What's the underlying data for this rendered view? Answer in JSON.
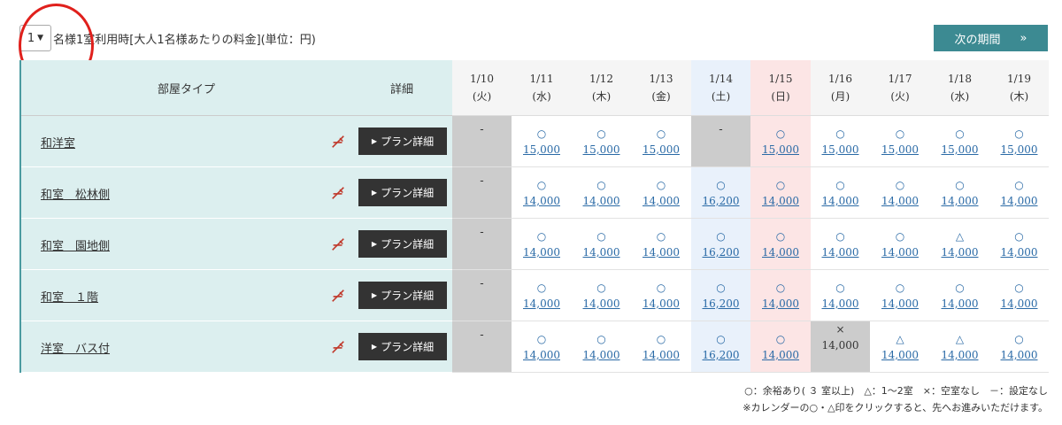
{
  "guests": {
    "selected": "1",
    "condition_text": "名様1室利用時[大人1名様あたりの料金](単位：円)"
  },
  "next_period": {
    "label": "次の期間",
    "arrow": "»"
  },
  "header": {
    "room_type": "部屋タイプ",
    "detail": "詳細"
  },
  "dates": [
    {
      "date": "1/10",
      "dow": "(火)",
      "kind": "weekday"
    },
    {
      "date": "1/11",
      "dow": "(水)",
      "kind": "weekday"
    },
    {
      "date": "1/12",
      "dow": "(木)",
      "kind": "weekday"
    },
    {
      "date": "1/13",
      "dow": "(金)",
      "kind": "weekday"
    },
    {
      "date": "1/14",
      "dow": "(土)",
      "kind": "sat"
    },
    {
      "date": "1/15",
      "dow": "(日)",
      "kind": "sun"
    },
    {
      "date": "1/16",
      "dow": "(月)",
      "kind": "weekday"
    },
    {
      "date": "1/17",
      "dow": "(火)",
      "kind": "weekday"
    },
    {
      "date": "1/18",
      "dow": "(水)",
      "kind": "weekday"
    },
    {
      "date": "1/19",
      "dow": "(木)",
      "kind": "weekday"
    }
  ],
  "plan_button_label": "プラン詳細",
  "no_smoking_icon": "no-smoking-icon",
  "rooms": [
    {
      "name": "和洋室",
      "cells": [
        {
          "mark": "-",
          "price": "",
          "status": "na"
        },
        {
          "mark": "○",
          "price": "15,000",
          "status": "ok"
        },
        {
          "mark": "○",
          "price": "15,000",
          "status": "ok"
        },
        {
          "mark": "○",
          "price": "15,000",
          "status": "ok"
        },
        {
          "mark": "-",
          "price": "",
          "status": "na"
        },
        {
          "mark": "○",
          "price": "15,000",
          "status": "ok"
        },
        {
          "mark": "○",
          "price": "15,000",
          "status": "ok"
        },
        {
          "mark": "○",
          "price": "15,000",
          "status": "ok"
        },
        {
          "mark": "○",
          "price": "15,000",
          "status": "ok"
        },
        {
          "mark": "○",
          "price": "15,000",
          "status": "ok"
        }
      ]
    },
    {
      "name": "和室　松林側",
      "cells": [
        {
          "mark": "-",
          "price": "",
          "status": "na"
        },
        {
          "mark": "○",
          "price": "14,000",
          "status": "ok"
        },
        {
          "mark": "○",
          "price": "14,000",
          "status": "ok"
        },
        {
          "mark": "○",
          "price": "14,000",
          "status": "ok"
        },
        {
          "mark": "○",
          "price": "16,200",
          "status": "ok"
        },
        {
          "mark": "○",
          "price": "14,000",
          "status": "ok"
        },
        {
          "mark": "○",
          "price": "14,000",
          "status": "ok"
        },
        {
          "mark": "○",
          "price": "14,000",
          "status": "ok"
        },
        {
          "mark": "○",
          "price": "14,000",
          "status": "ok"
        },
        {
          "mark": "○",
          "price": "14,000",
          "status": "ok"
        }
      ]
    },
    {
      "name": "和室　園地側",
      "cells": [
        {
          "mark": "-",
          "price": "",
          "status": "na"
        },
        {
          "mark": "○",
          "price": "14,000",
          "status": "ok"
        },
        {
          "mark": "○",
          "price": "14,000",
          "status": "ok"
        },
        {
          "mark": "○",
          "price": "14,000",
          "status": "ok"
        },
        {
          "mark": "○",
          "price": "16,200",
          "status": "ok"
        },
        {
          "mark": "○",
          "price": "14,000",
          "status": "ok"
        },
        {
          "mark": "○",
          "price": "14,000",
          "status": "ok"
        },
        {
          "mark": "○",
          "price": "14,000",
          "status": "ok"
        },
        {
          "mark": "△",
          "price": "14,000",
          "status": "ok"
        },
        {
          "mark": "○",
          "price": "14,000",
          "status": "ok"
        }
      ]
    },
    {
      "name": "和室　１階",
      "cells": [
        {
          "mark": "-",
          "price": "",
          "status": "na"
        },
        {
          "mark": "○",
          "price": "14,000",
          "status": "ok"
        },
        {
          "mark": "○",
          "price": "14,000",
          "status": "ok"
        },
        {
          "mark": "○",
          "price": "14,000",
          "status": "ok"
        },
        {
          "mark": "○",
          "price": "16,200",
          "status": "ok"
        },
        {
          "mark": "○",
          "price": "14,000",
          "status": "ok"
        },
        {
          "mark": "○",
          "price": "14,000",
          "status": "ok"
        },
        {
          "mark": "○",
          "price": "14,000",
          "status": "ok"
        },
        {
          "mark": "○",
          "price": "14,000",
          "status": "ok"
        },
        {
          "mark": "○",
          "price": "14,000",
          "status": "ok"
        }
      ]
    },
    {
      "name": "洋室　バス付",
      "cells": [
        {
          "mark": "-",
          "price": "",
          "status": "na"
        },
        {
          "mark": "○",
          "price": "14,000",
          "status": "ok"
        },
        {
          "mark": "○",
          "price": "14,000",
          "status": "ok"
        },
        {
          "mark": "○",
          "price": "14,000",
          "status": "ok"
        },
        {
          "mark": "○",
          "price": "16,200",
          "status": "ok"
        },
        {
          "mark": "○",
          "price": "14,000",
          "status": "ok"
        },
        {
          "mark": "×",
          "price": "14,000",
          "status": "full"
        },
        {
          "mark": "△",
          "price": "14,000",
          "status": "ok"
        },
        {
          "mark": "△",
          "price": "14,000",
          "status": "ok"
        },
        {
          "mark": "○",
          "price": "14,000",
          "status": "ok"
        }
      ]
    }
  ],
  "legend": {
    "line1": "○：余裕あり( ３ 室以上)　△：1～2室　×：空室なし　－：設定なし",
    "line2": "※カレンダーの○・△印をクリックすると、先へお進みいただけます。"
  },
  "colors": {
    "accent": "#3c8a92",
    "room_bg": "#dcefef",
    "sat_bg": "#e9f1fb",
    "sun_bg": "#fce5e5",
    "na_bg": "#cccccc",
    "annotation": "#e0201c"
  }
}
